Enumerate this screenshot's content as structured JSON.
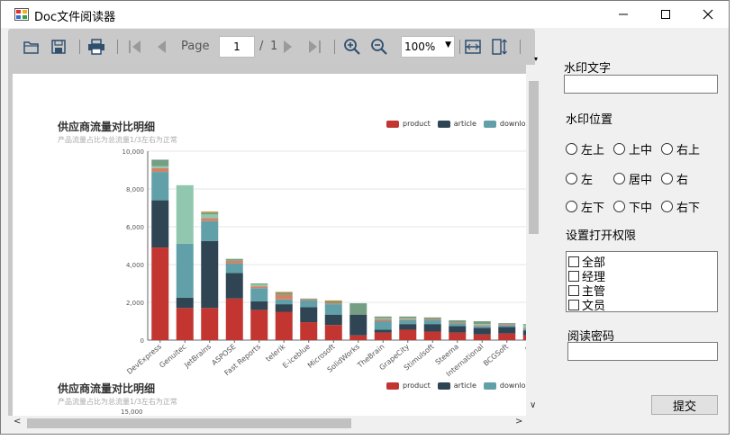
{
  "window": {
    "title": "Doc文件阅读器",
    "controls": {
      "minimize": "—",
      "maximize": "☐",
      "close": "✕"
    }
  },
  "toolbar": {
    "page_label": "Page",
    "page_value": "1",
    "page_sep": "/",
    "page_total": "1",
    "zoom_value": "100%"
  },
  "sidebar": {
    "watermark_text_label": "水印文字",
    "watermark_text_value": "",
    "watermark_position_label": "水印位置",
    "positions": [
      "左上",
      "上中",
      "右上",
      "左",
      "居中",
      "右",
      "左下",
      "下中",
      "右下"
    ],
    "permission_label": "设置打开权限",
    "permissions": [
      "全部",
      "经理",
      "主管",
      "文员"
    ],
    "password_label": "阅读密码",
    "password_value": "",
    "submit_label": "提交"
  },
  "document": {
    "chart1_title": "供应商流量对比明细",
    "chart1_subtitle": "产品流量占比为总流量1/3左右为正常",
    "chart2_title": "供应商流量对比明细",
    "chart2_subtitle": "产品流量占比为总流量1/3左右为正常",
    "chart2_ytick_top": "15,000"
  },
  "chart_data": {
    "type": "bar",
    "stacked": true,
    "title": "供应商流量对比明细",
    "subtitle": "产品流量占比为总流量1/3左右为正常",
    "categories": [
      "DevExpress",
      "Genuitec",
      "JetBrains",
      "ASPOSE",
      "Fast Reports",
      "telerik",
      "E-iceblue",
      "Microsoft",
      "SolidWorks",
      "TheBrain",
      "GrapeCity",
      "Stimulsoft",
      "Steema",
      "International",
      "BCGSoft",
      "Oi"
    ],
    "yticks": [
      "0",
      "2,000",
      "4,000",
      "6,000",
      "8,000",
      "10,000"
    ],
    "ylim": [
      0,
      10000
    ],
    "legend": [
      "product",
      "article",
      "download"
    ],
    "series": [
      {
        "name": "product",
        "color": "#c23531",
        "values": [
          4900,
          1700,
          1700,
          2200,
          1600,
          1500,
          950,
          800,
          250,
          400,
          550,
          450,
          400,
          300,
          350,
          250
        ]
      },
      {
        "name": "article",
        "color": "#2f4554",
        "values": [
          2500,
          550,
          3550,
          1350,
          450,
          400,
          800,
          550,
          1100,
          150,
          300,
          400,
          350,
          350,
          350,
          250
        ]
      },
      {
        "name": "download",
        "color": "#61a0a8",
        "values": [
          1500,
          2850,
          1050,
          500,
          700,
          250,
          350,
          550,
          0,
          450,
          200,
          200,
          150,
          100,
          100,
          100
        ]
      },
      {
        "name": "",
        "color": "#d48265",
        "values": [
          200,
          0,
          150,
          150,
          100,
          250,
          50,
          50,
          0,
          100,
          50,
          50,
          50,
          50,
          50,
          50
        ]
      },
      {
        "name": "",
        "color": "#91c7ae",
        "values": [
          100,
          3100,
          200,
          0,
          100,
          0,
          0,
          0,
          0,
          50,
          50,
          0,
          0,
          50,
          0,
          150
        ]
      },
      {
        "name": "",
        "color": "#749f83",
        "values": [
          350,
          0,
          100,
          100,
          50,
          100,
          50,
          100,
          600,
          100,
          100,
          100,
          100,
          150,
          50,
          50
        ]
      },
      {
        "name": "",
        "color": "#ca8622",
        "values": [
          0,
          0,
          50,
          0,
          0,
          50,
          0,
          50,
          0,
          0,
          0,
          0,
          0,
          0,
          0,
          0
        ]
      }
    ]
  }
}
